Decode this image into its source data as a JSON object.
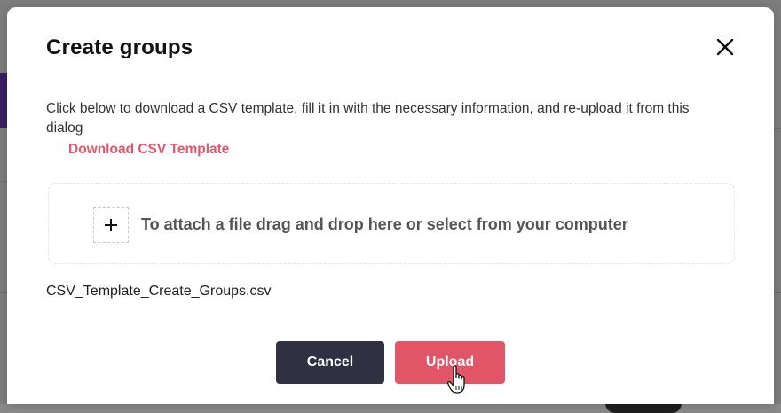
{
  "dialog": {
    "title": "Create groups",
    "description": "Click below to download a CSV template, fill it in with the necessary information, and re-upload it from this dialog",
    "download_link_label": "Download CSV Template",
    "dropzone_text": "To attach a file drag and drop here or select from your computer",
    "selected_file_name": "CSV_Template_Create_Groups.csv",
    "cancel_label": "Cancel",
    "upload_label": "Upload"
  },
  "icons": {
    "close": "close-icon",
    "add": "plus-icon",
    "cursor": "hand-pointer-icon"
  },
  "colors": {
    "accent": "#e0566b",
    "upload_button": "#e25566",
    "cancel_button": "#2f3142",
    "title_text": "#121212"
  }
}
